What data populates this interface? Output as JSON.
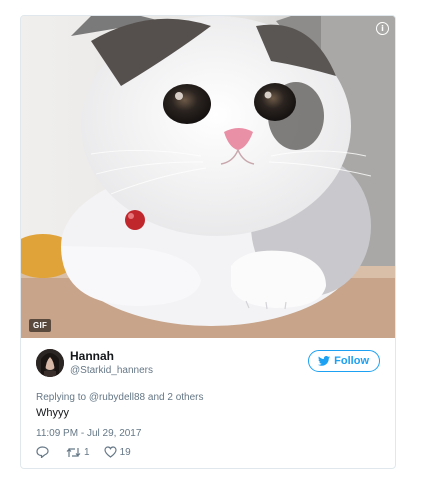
{
  "media": {
    "gif_badge": "GIF",
    "info_icon": "info-icon"
  },
  "tweet": {
    "display_name": "Hannah",
    "handle": "@Starkid_hanners",
    "follow_label": "Follow",
    "replying_prefix": "Replying to",
    "replying_user": "@rubydell88",
    "replying_suffix": "and 2 others",
    "text": "Whyyy",
    "timestamp": "11:09 PM - Jul 29, 2017",
    "reply_icon": "reply-icon",
    "retweet_count": "1",
    "like_count": "19"
  },
  "colors": {
    "accent": "#1da1f2",
    "muted": "#657786",
    "text": "#14171a",
    "border": "#e1e8ed"
  }
}
